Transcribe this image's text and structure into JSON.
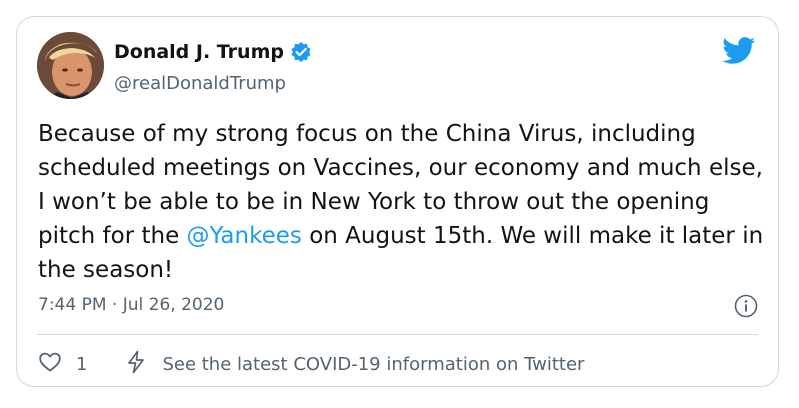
{
  "author": {
    "display_name": "Donald J. Trump",
    "handle": "@realDonaldTrump",
    "verified": true
  },
  "tweet": {
    "text_before_mention": "Because of my strong focus on the China Virus, including scheduled meetings on Vaccines, our economy and much else, I won’t be able to be in New York to throw out the opening pitch for the ",
    "mention": "@Yankees",
    "text_after_mention": " on August 15th. We will make it later in the season!",
    "timestamp": "7:44 PM · Jul 26, 2020"
  },
  "actions": {
    "like_count": "1",
    "covid_link": "See the latest COVID-19 information on Twitter"
  },
  "icons": {
    "brand": "twitter-bird-icon",
    "verified": "verified-badge-icon",
    "info": "info-icon",
    "like": "heart-icon",
    "covid": "lightning-bolt-icon"
  },
  "colors": {
    "accent": "#1d9bf0",
    "text": "#0f1419",
    "muted": "#536471",
    "border": "#cfd9de"
  }
}
